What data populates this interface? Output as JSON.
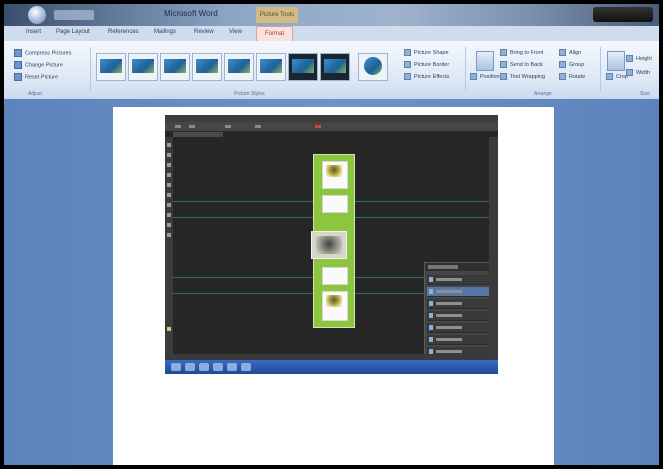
{
  "window": {
    "title": "Microsoft Word",
    "contextual_title": "Picture Tools"
  },
  "tabs": [
    "Insert",
    "Page Layout",
    "References",
    "Mailings",
    "Review",
    "View",
    "Format"
  ],
  "active_tab": "Format",
  "ribbon": {
    "adjust": {
      "items": [
        "Compress Pictures",
        "Change Picture",
        "Reset Picture"
      ],
      "label": "Adjust"
    },
    "picture_styles": {
      "label": "Picture Styles",
      "commands": [
        "Picture Shape",
        "Picture Border",
        "Picture Effects"
      ]
    },
    "arrange": {
      "label": "Arrange",
      "position": "Position",
      "commands": [
        "Bring to Front",
        "Send to Back",
        "Text Wrapping",
        "Align",
        "Group",
        "Rotate"
      ]
    },
    "size": {
      "label": "Size",
      "crop": "Crop",
      "height": "Height",
      "width": "Width"
    }
  },
  "colors": {
    "word_background": "#5f86bd",
    "photoshop_workspace": "#2d2d2d",
    "strip_green": "#8cc63f",
    "active_tab_red": "#b33333"
  },
  "icons": [
    "office-orb-icon",
    "picture-style-thumbnail-icon",
    "photoshop-tool-icon",
    "layer-visibility-icon",
    "taskbar-app-icon"
  ]
}
